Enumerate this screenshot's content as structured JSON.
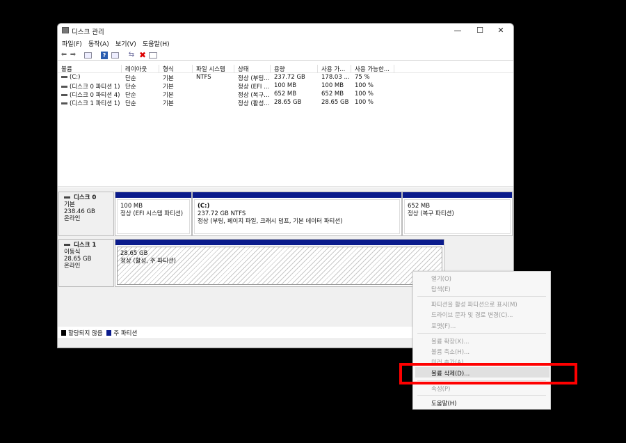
{
  "window": {
    "title": "디스크 관리",
    "min_glyph": "—",
    "max_glyph": "☐",
    "close_glyph": "✕"
  },
  "menu": [
    "파일(F)",
    "동작(A)",
    "보기(V)",
    "도움말(H)"
  ],
  "toolbar": {
    "back_glyph": "⬅",
    "fwd_glyph": "➡",
    "help_glyph": "?",
    "delete_glyph": "✖",
    "connect_glyph": "⇆"
  },
  "volume_table": {
    "headers": [
      "볼륨",
      "레이아웃",
      "형식",
      "파일 시스템",
      "상태",
      "용량",
      "사용 가...",
      "사용 가능한..."
    ],
    "rows": [
      [
        "(C:)",
        "단순",
        "기본",
        "NTFS",
        "정상 (부팅...",
        "237.72 GB",
        "178.03 ...",
        "75 %"
      ],
      [
        "(디스크 0 파티션 1)",
        "단순",
        "기본",
        "",
        "정상 (EFI ...",
        "100 MB",
        "100 MB",
        "100 %"
      ],
      [
        "(디스크 0 파티션 4)",
        "단순",
        "기본",
        "",
        "정상 (복구...",
        "652 MB",
        "652 MB",
        "100 %"
      ],
      [
        "(디스크 1 파티션 1)",
        "단순",
        "기본",
        "",
        "정상 (활성...",
        "28.65 GB",
        "28.65 GB",
        "100 %"
      ]
    ]
  },
  "disks": {
    "disk0": {
      "name": "디스크 0",
      "type": "기본",
      "size": "238.46 GB",
      "status": "온라인",
      "partitions": [
        {
          "line1": "",
          "line2": "100 MB",
          "line3": "정상 (EFI 시스템 파티션)"
        },
        {
          "line1": "(C:)",
          "line2": "237.72 GB NTFS",
          "line3": "정상 (부팅, 페이지 파일, 크래시 덤프, 기본 데이터 파티션)"
        },
        {
          "line1": "",
          "line2": "652 MB",
          "line3": "정상 (복구 파티션)"
        }
      ]
    },
    "disk1": {
      "name": "디스크 1",
      "type": "이동식",
      "size": "28.65 GB",
      "status": "온라인",
      "partitions": [
        {
          "line1": "",
          "line2": "28.65 GB",
          "line3": "정상 (활성, 주 파티션)"
        }
      ]
    }
  },
  "legend": {
    "unallocated": "할당되지 않음",
    "primary": "주 파티션",
    "colors": {
      "unallocated": "#000000",
      "primary": "#0a1b8c"
    }
  },
  "context_menu": {
    "items": [
      {
        "label": "열기(O)",
        "enabled": false
      },
      {
        "label": "탐색(E)",
        "enabled": false
      },
      {
        "label": "파티션을 활성 파티션으로 표시(M)",
        "enabled": false
      },
      {
        "label": "드라이브 문자 및 경로 변경(C)...",
        "enabled": false
      },
      {
        "label": "포맷(F)...",
        "enabled": false
      },
      {
        "label": "볼륨 확장(X)...",
        "enabled": false
      },
      {
        "label": "볼륨 축소(H)...",
        "enabled": false
      },
      {
        "label": "미러 추가(A)...",
        "enabled": false
      },
      {
        "label": "볼륨 삭제(D)...",
        "enabled": true,
        "highlighted": true
      },
      {
        "label": "속성(P)",
        "enabled": false
      },
      {
        "label": "도움말(H)",
        "enabled": true
      }
    ]
  },
  "highlight_color": "#ff0000"
}
